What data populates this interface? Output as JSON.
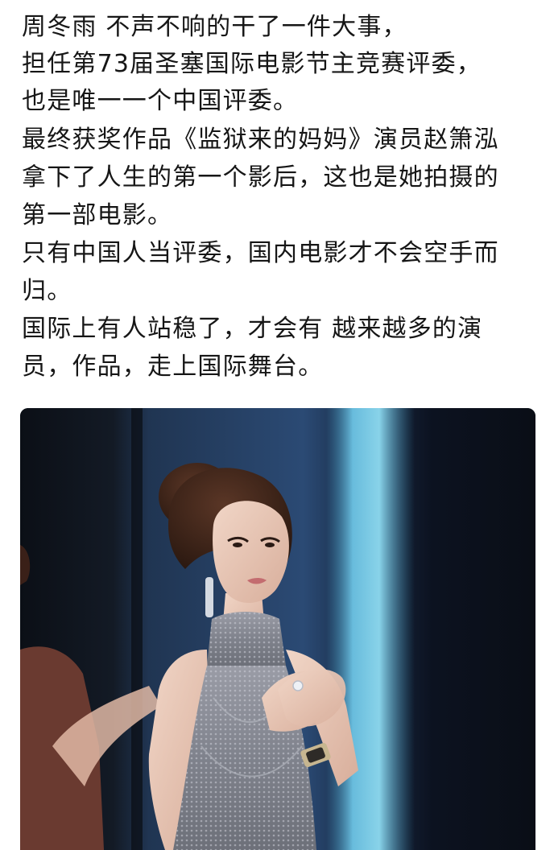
{
  "post": {
    "lines": [
      "周冬雨 不声不响的干了一件大事，",
      "担任第73届圣塞国际电影节主竞赛评委，",
      "也是唯一一个中国评委。",
      "最终获奖作品《监狱来的妈妈》演员赵箫泓",
      "拿下了人生的第一个影后，这也是她拍摄的",
      "第一部电影。",
      "只有中国人当评委，国内电影才不会空手而",
      "归。",
      "国际上有人站稳了，才会有 越来越多的演",
      "员，作品，走上国际舞台。"
    ]
  },
  "image": {
    "subject": "woman-in-sequined-halter-gown-clapping-on-stage",
    "colors": {
      "backdrop_dark": "#0f141c",
      "backdrop_blue": "#2b4a74",
      "light_strip": "#7fd0ea",
      "gown": "#8a8d97",
      "skin": "#e9c9b8",
      "hair": "#3b241a",
      "left_figure": "#6a3a30"
    }
  }
}
